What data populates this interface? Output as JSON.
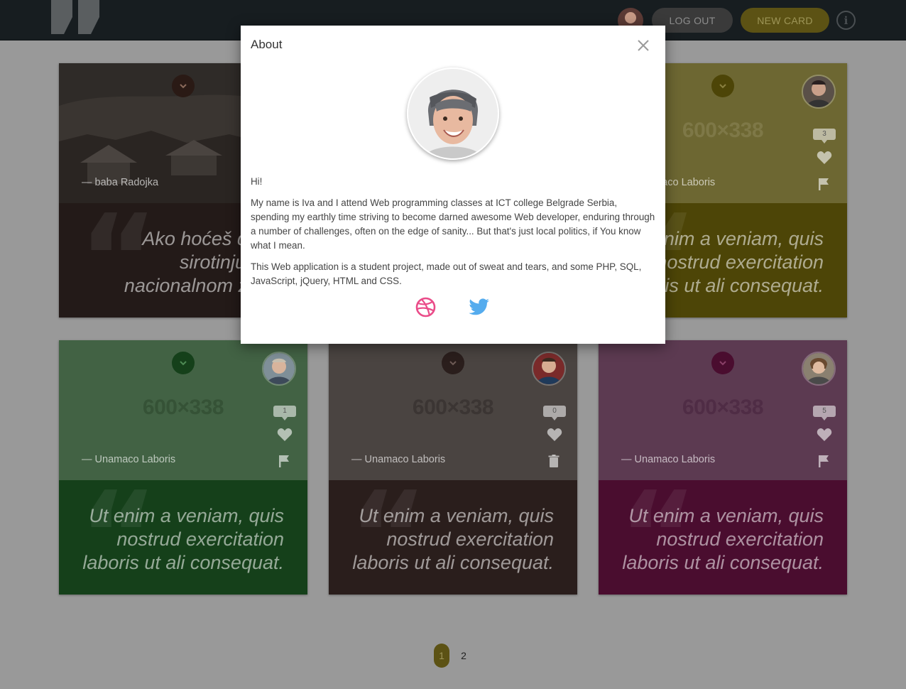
{
  "header": {
    "logout_label": "LOG OUT",
    "newcard_label": "NEW CARD",
    "info_icon": "i"
  },
  "cards": [
    {
      "placeholder": "",
      "author": "— baba Radojka",
      "quote": "Ako hoćeš da sa\nsirotinju, pre\nnacionalnom zasta",
      "count": "",
      "colors": {
        "upper": "#2e2a27",
        "lower": "#231a18",
        "chevron": "#2a1a15"
      }
    },
    {
      "placeholder": "600×338",
      "author": "— Unamaco Laboris",
      "quote": "Ut enim a veniam, quis\nnostrud exercitation\nlaboris ut ali consequat.",
      "count": "3",
      "colors": {
        "upper": "#6d6732",
        "lower": "#4d4507",
        "chevron": "#4d4507"
      }
    },
    {
      "placeholder": "600×338",
      "author": "— Unamaco Laboris",
      "quote": "Ut enim a veniam, quis\nnostrud exercitation\nlaboris ut ali consequat.",
      "count": "1",
      "colors": {
        "upper": "#426244",
        "lower": "#15401a",
        "chevron": "#15401a"
      }
    },
    {
      "placeholder": "600×338",
      "author": "— Unamaco Laboris",
      "quote": "Ut enim a veniam, quis\nnostrud exercitation\nlaboris ut ali consequat.",
      "count": "0",
      "colors": {
        "upper": "#4a4441",
        "lower": "#2a1e1c",
        "chevron": "#2a1e1c"
      }
    },
    {
      "placeholder": "600×338",
      "author": "— Unamaco Laboris",
      "quote": "Ut enim a veniam, quis\nnostrud exercitation\nlaboris ut ali consequat.",
      "count": "5",
      "colors": {
        "upper": "#5c3a51",
        "lower": "#4a0d2f",
        "chevron": "#4a0d2f"
      }
    }
  ],
  "modal": {
    "title": "About",
    "greeting": "Hi!",
    "paragraph1": "My name is Iva and I attend Web programming classes at ICT college Belgrade Serbia, spending my earthly time striving to become darned awesome Web developer, enduring through a number of challenges, often on the edge of sanity... But that's just local politics, if You know what I mean.",
    "paragraph2": "This Web application is a student project, made out of sweat and tears, and some PHP, SQL, JavaScript, jQuery, HTML and CSS.",
    "social": [
      "dribbble-icon",
      "twitter-icon"
    ]
  },
  "pagination": {
    "pages": [
      "1",
      "2"
    ],
    "current": "1"
  },
  "icons": {
    "chevron": "chevron-down-icon",
    "heart": "heart-icon",
    "flag": "flag-icon",
    "trash": "trash-icon",
    "close": "close-icon"
  }
}
